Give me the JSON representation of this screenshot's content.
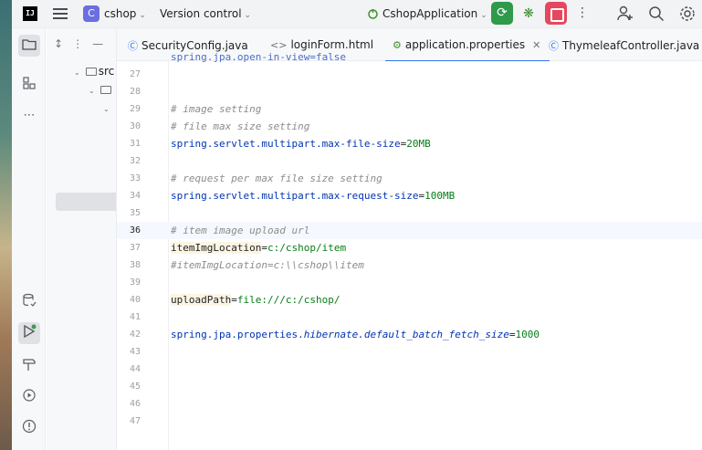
{
  "app": {
    "logo_text": "IJ",
    "project_badge": "C",
    "project_name": "cshop",
    "vcs_label": "Version control",
    "run_config": "CshopApplication"
  },
  "project_panel": {
    "tree": [
      {
        "label": "src"
      }
    ]
  },
  "tabs": [
    {
      "label": "SecurityConfig.java",
      "icon": "class-icon"
    },
    {
      "label": "loginForm.html",
      "icon": "html-icon"
    },
    {
      "label": "application.properties",
      "icon": "properties-icon",
      "active": true
    },
    {
      "label": "ThymeleafController.java",
      "icon": "class-icon"
    }
  ],
  "editor": {
    "current_line": "36",
    "lines": [
      {
        "n": "27",
        "text": ""
      },
      {
        "n": "28",
        "text": ""
      },
      {
        "n": "29",
        "text": "# image setting"
      },
      {
        "n": "30",
        "text": "# file max size setting"
      },
      {
        "n": "31",
        "key": "spring.servlet.multipart.max-file-size",
        "value": "20MB"
      },
      {
        "n": "32",
        "text": ""
      },
      {
        "n": "33",
        "text": "# request per max file size setting"
      },
      {
        "n": "34",
        "key": "spring.servlet.multipart.max-request-size",
        "value": "100MB"
      },
      {
        "n": "35",
        "text": ""
      },
      {
        "n": "36",
        "text": "# item image upload url"
      },
      {
        "n": "37",
        "key": "itemImgLocation",
        "value": "c:/cshop/item"
      },
      {
        "n": "38",
        "text": "#itemImgLocation=c:\\\\cshop\\\\item"
      },
      {
        "n": "39",
        "text": ""
      },
      {
        "n": "40",
        "key": "uploadPath",
        "value": "file:///c:/cshop/"
      },
      {
        "n": "41",
        "text": ""
      },
      {
        "n": "42",
        "key_prefix": "spring.jpa.properties.",
        "key_italic": "hibernate.default_batch_fetch_size",
        "value": "1000"
      },
      {
        "n": "43",
        "text": ""
      },
      {
        "n": "44",
        "text": ""
      },
      {
        "n": "45",
        "text": ""
      },
      {
        "n": "46",
        "text": ""
      },
      {
        "n": "47",
        "text": ""
      }
    ]
  }
}
